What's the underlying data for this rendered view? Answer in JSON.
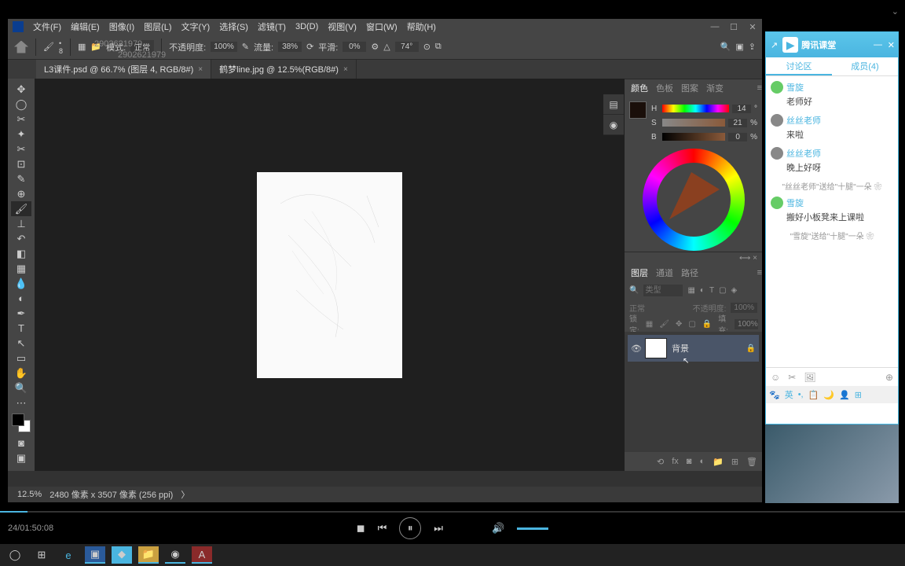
{
  "menu": [
    "文件(F)",
    "编辑(E)",
    "图像(I)",
    "图层(L)",
    "文字(Y)",
    "选择(S)",
    "滤镜(T)",
    "3D(D)",
    "视图(V)",
    "窗口(W)",
    "帮助(H)"
  ],
  "overlay1": "2902621979",
  "overlay2": "2902621979",
  "options": {
    "brush_size": "8",
    "mode_label": "模式:",
    "mode_val": "正常",
    "opacity_label": "不透明度:",
    "opacity_val": "100%",
    "flow_label": "流量:",
    "flow_val": "38%",
    "smooth_label": "平滑:",
    "smooth_val": "0%",
    "angle": "74°"
  },
  "tabs": [
    {
      "name": "L3课件.psd @ 66.7% (图层 4, RGB/8#)"
    },
    {
      "name": "鹤梦line.jpg @ 12.5%(RGB/8#)"
    }
  ],
  "status": {
    "zoom": "12.5%",
    "dims": "2480 像素 x 3507 像素 (256 ppi)",
    "arrow": "〉"
  },
  "color": {
    "tabs": [
      "颜色",
      "色板",
      "图案",
      "渐变"
    ],
    "h": "14",
    "s": "21",
    "b": "0",
    "unit": "°",
    "unit2": "%"
  },
  "layers": {
    "tabs": [
      "图层",
      "通道",
      "路径"
    ],
    "search_placeholder": "类型",
    "opacity_label": "不透明度:",
    "opacity_val": "100%",
    "mode": "正常",
    "lock_label": "锁定:",
    "fill_label": "填充:",
    "fill_val": "100%",
    "layer_name": "背景"
  },
  "chat": {
    "title": "腾讯课堂",
    "tabs": [
      "讨论区",
      "成员(4)"
    ],
    "msgs": [
      {
        "user": "雪旋",
        "text": "老师好",
        "type": "g"
      },
      {
        "user": "丝丝老师",
        "text": "来啦",
        "type": "p"
      },
      {
        "user": "丝丝老师",
        "text": "晚上好呀",
        "type": "p"
      },
      {
        "gift": "\"丝丝老师\"送给\"十腿\"一朵 ❀"
      },
      {
        "user": "雪旋",
        "text": "搬好小板凳来上课啦",
        "type": "g"
      },
      {
        "gift": "\"雪旋\"送给\"十腿\"一朵 ❀"
      }
    ],
    "ime": [
      "🐾",
      "英",
      "•,",
      "📋",
      "🌙",
      "👤",
      "⊞"
    ]
  },
  "player": {
    "time": "24/01:50:08"
  }
}
